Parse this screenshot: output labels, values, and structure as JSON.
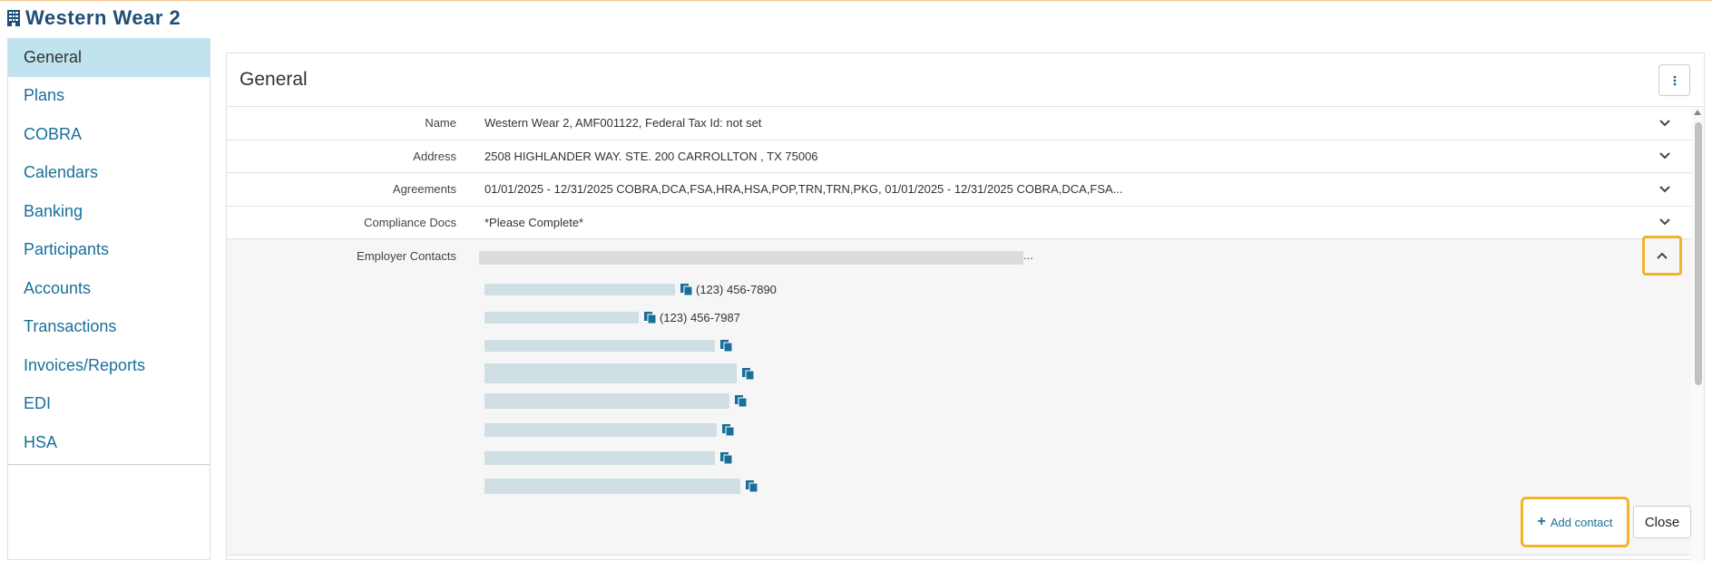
{
  "app": {
    "title": "Western Wear 2"
  },
  "sidebar": {
    "items": [
      {
        "label": "General",
        "active": true
      },
      {
        "label": "Plans"
      },
      {
        "label": "COBRA"
      },
      {
        "label": "Calendars"
      },
      {
        "label": "Banking"
      },
      {
        "label": "Participants"
      },
      {
        "label": "Accounts"
      },
      {
        "label": "Transactions"
      },
      {
        "label": "Invoices/Reports"
      },
      {
        "label": "EDI"
      },
      {
        "label": "HSA"
      }
    ]
  },
  "panel": {
    "title": "General",
    "rows": [
      {
        "label": "Name",
        "value": "Western Wear 2, AMF001122, Federal Tax Id: not set"
      },
      {
        "label": "Address",
        "value": "2508 HIGHLANDER WAY. STE. 200 CARROLLTON , TX 75006"
      },
      {
        "label": "Agreements",
        "value": "01/01/2025 - 12/31/2025 COBRA,DCA,FSA,HRA,HSA,POP,TRN,TRN,PKG, 01/01/2025 - 12/31/2025 COBRA,DCA,FSA..."
      },
      {
        "label": "Compliance Docs",
        "value": "*Please Complete*"
      }
    ],
    "contacts": {
      "label": "Employer Contacts",
      "summary_suffix": "...",
      "items": [
        {
          "phone": "(123) 456-7890"
        },
        {
          "phone": "(123) 456-7987"
        },
        {
          "phone": ""
        },
        {
          "phone": ""
        },
        {
          "phone": ""
        },
        {
          "phone": ""
        },
        {
          "phone": ""
        },
        {
          "phone": ""
        }
      ],
      "add_label": "Add contact",
      "close_label": "Close"
    }
  },
  "colors": {
    "accent": "#1a6f9a",
    "highlight": "#f0b429",
    "active_nav": "#bfe3ef",
    "title": "#1f4e79"
  },
  "icons": {
    "header": "building-icon",
    "menu": "kebab-icon",
    "copy": "copy-icon",
    "expand": "chevron-down-icon",
    "collapse": "chevron-up-icon",
    "add": "plus-icon"
  }
}
